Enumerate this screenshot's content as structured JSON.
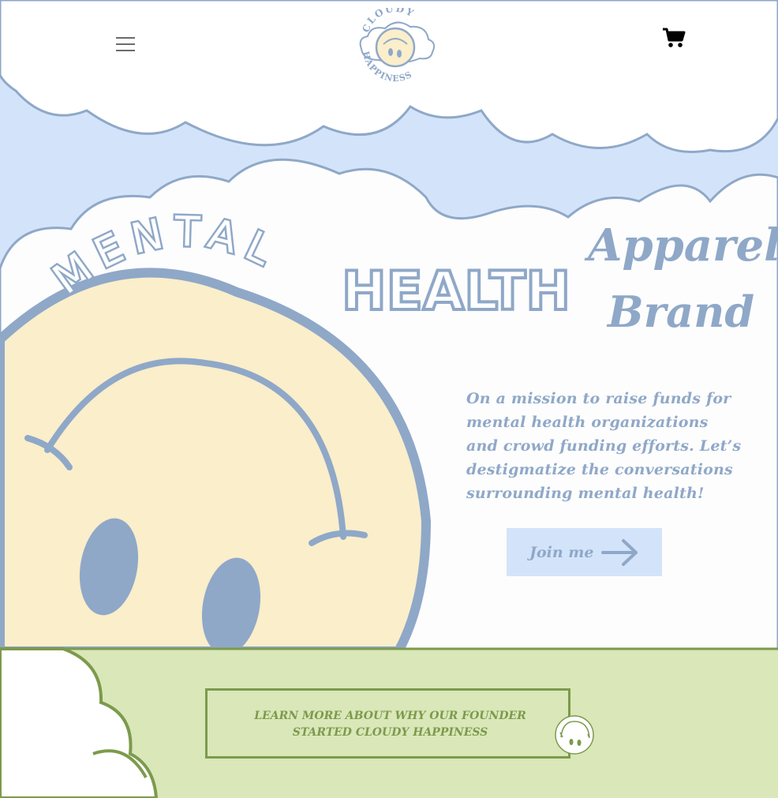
{
  "header": {
    "menu_icon": "hamburger-menu-icon",
    "cart_icon": "shopping-cart-icon",
    "logo_top": "CLOUDY",
    "logo_bottom": "HAPPINESS"
  },
  "hero": {
    "word_mental": "MENTAL",
    "word_health": "HEALTH",
    "word_apparel": "Apparel",
    "word_brand": "Brand",
    "mission": "On a mission to raise funds for mental health organizations and crowd funding efforts. Let’s destigmatize the conversations surrounding mental health!",
    "join_label": "Join me",
    "join_icon": "arrow-right-icon"
  },
  "about": {
    "learn_label": "LEARN MORE ABOUT WHY OUR FOUNDER STARTED CLOUDY HAPPINESS",
    "learn_icon": "smiley-cloud-icon"
  },
  "colors": {
    "sky_blue": "#d3e4fa",
    "outline_blue": "#8fa8c8",
    "smiley_yellow": "#faeecb",
    "green_band": "#d9e7b9",
    "green_outline": "#7d9a4c"
  }
}
